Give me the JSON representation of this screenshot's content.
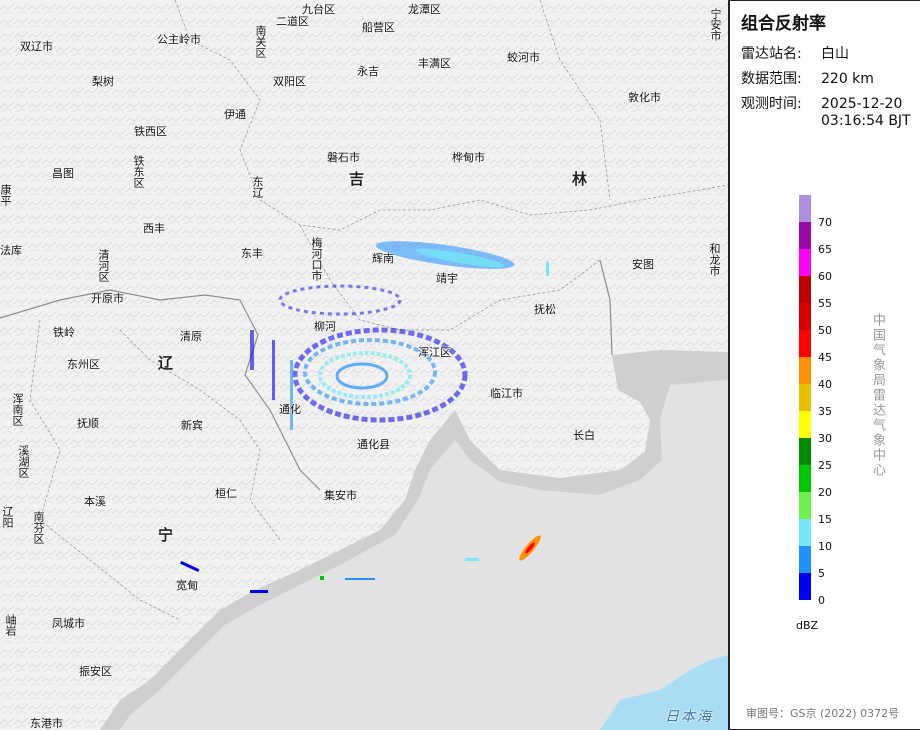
{
  "panel": {
    "title": "组合反射率",
    "station_label": "雷达站名:",
    "station_value": "白山",
    "range_label": "数据范围:",
    "range_value": "220 km",
    "time_label": "观测时间:",
    "time_date": "2025-12-20",
    "time_clock": "03:16:54 BJT",
    "unit": "dBZ",
    "agency": "中国气象局雷达气象中心",
    "approval": "审图号：GS京 (2022) 0372号"
  },
  "legend": [
    {
      "value": "70",
      "color": "#ae8fe0"
    },
    {
      "value": "65",
      "color": "#9a0aa8"
    },
    {
      "value": "60",
      "color": "#ff00f0"
    },
    {
      "value": "55",
      "color": "#c00000"
    },
    {
      "value": "50",
      "color": "#d60000"
    },
    {
      "value": "45",
      "color": "#ff0000"
    },
    {
      "value": "40",
      "color": "#ff9000"
    },
    {
      "value": "35",
      "color": "#e7c000"
    },
    {
      "value": "30",
      "color": "#ffff00"
    },
    {
      "value": "25",
      "color": "#008a00"
    },
    {
      "value": "20",
      "color": "#00c800"
    },
    {
      "value": "15",
      "color": "#6ef050"
    },
    {
      "value": "10",
      "color": "#74e8f4"
    },
    {
      "value": "5",
      "color": "#1e90ff"
    },
    {
      "value": "0",
      "color": "#0000f6"
    }
  ],
  "places": [
    {
      "name": "双辽市"
    },
    {
      "name": "公主岭市"
    },
    {
      "name": "二道区"
    },
    {
      "name": "九台区"
    },
    {
      "name": "船营区"
    },
    {
      "name": "龙潭区"
    },
    {
      "name": "蛟河市"
    },
    {
      "name": "丰满区"
    },
    {
      "name": "永吉"
    },
    {
      "name": "双阳区"
    },
    {
      "name": "梨树"
    },
    {
      "name": "伊通"
    },
    {
      "name": "铁西区"
    },
    {
      "name": "铁东区"
    },
    {
      "name": "昌图"
    },
    {
      "name": "东辽"
    },
    {
      "name": "磐石市"
    },
    {
      "name": "桦甸市"
    },
    {
      "name": "敦化市"
    },
    {
      "name": "西丰"
    },
    {
      "name": "东丰"
    },
    {
      "name": "梅河口市"
    },
    {
      "name": "辉南"
    },
    {
      "name": "靖宇"
    },
    {
      "name": "安图"
    },
    {
      "name": "抚松"
    },
    {
      "name": "清河区"
    },
    {
      "name": "开原市"
    },
    {
      "name": "铁岭"
    },
    {
      "name": "东州区"
    },
    {
      "name": "清原"
    },
    {
      "name": "柳河"
    },
    {
      "name": "浑江区"
    },
    {
      "name": "临江市"
    },
    {
      "name": "通化"
    },
    {
      "name": "浑南区"
    },
    {
      "name": "抚顺"
    },
    {
      "name": "新宾"
    },
    {
      "name": "集安市"
    },
    {
      "name": "长白"
    },
    {
      "name": "溪湖区"
    },
    {
      "name": "本溪"
    },
    {
      "name": "桓仁"
    },
    {
      "name": "南芬区"
    },
    {
      "name": "宽甸"
    },
    {
      "name": "凤城市"
    },
    {
      "name": "振安区"
    },
    {
      "name": "东港市"
    },
    {
      "name": "法库"
    },
    {
      "name": "康平"
    },
    {
      "name": "岫岩"
    },
    {
      "name": "辽阳"
    },
    {
      "name": "南关区"
    },
    {
      "name": "宁安市"
    },
    {
      "name": "和龙市"
    },
    {
      "name": "通化县"
    }
  ],
  "provinces": [
    {
      "name": "吉"
    },
    {
      "name": "林"
    },
    {
      "name": "辽"
    },
    {
      "name": "宁"
    }
  ],
  "sea": "日本海"
}
